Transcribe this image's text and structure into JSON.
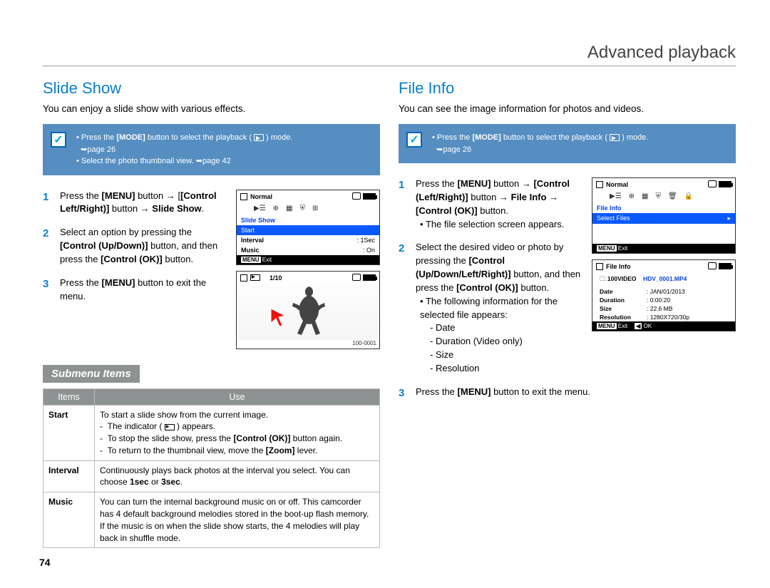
{
  "header": {
    "title": "Advanced playback"
  },
  "page_number": "74",
  "left": {
    "title": "Slide Show",
    "intro": "You can enjoy a slide show with various effects.",
    "callout": {
      "line1_pre": "Press the ",
      "line1_bold": "[MODE]",
      "line1_mid": " button to select the playback ( ",
      "line1_post": " ) mode. ",
      "line1_ref": "➥page 26",
      "line2": "Select the photo thumbnail view. ➥page 42"
    },
    "steps": {
      "s1": {
        "num": "1",
        "a": "Press the ",
        "b1": "[MENU]",
        "c": " button → ",
        "b2": "[Control Left/Right)]",
        "d": " button → ",
        "b3": "Slide Show",
        "e": "."
      },
      "s2": {
        "num": "2",
        "a": "Select an option by pressing the ",
        "b1": "[Control (Up/Down)]",
        "c": " button, and then press the ",
        "b2": "[Control (OK)]",
        "d": " button."
      },
      "s3": {
        "num": "3",
        "a": "Press the ",
        "b1": "[MENU]",
        "c": " button to exit the menu."
      }
    },
    "screen1": {
      "bar_label": "Normal",
      "menu_title": "Slide Show",
      "row1": "Start",
      "row2_label": "Interval",
      "row2_val": ": 1Sec",
      "row3_label": "Music",
      "row3_val": ": On",
      "footer_menu": "MENU",
      "footer_exit": "Exit"
    },
    "screen2": {
      "counter": "1/10",
      "footer_id": "100-0001"
    },
    "sub_heading": "Submenu Items",
    "table": {
      "h1": "Items",
      "h2": "Use",
      "r1_label": "Start",
      "r1_l1": "To start a slide show from the current image.",
      "r1_l2a": "The indicator ( ",
      "r1_l2b": " ) appears.",
      "r1_l3a": "To stop the slide show, press the ",
      "r1_l3b": "[Control (OK)]",
      "r1_l3c": " button again.",
      "r1_l4a": "To return to the thumbnail view, move the ",
      "r1_l4b": "[Zoom]",
      "r1_l4c": " lever.",
      "r2_label": "Interval",
      "r2_l1a": "Continuously plays back photos at the interval you select. You can choose ",
      "r2_l1b": "1sec",
      "r2_l1c": " or ",
      "r2_l1d": "3sec",
      "r2_l1e": ".",
      "r3_label": "Music",
      "r3_text": "You can turn the internal background music on or off. This camcorder has 4 default background melodies stored in the boot-up flash memory. If the music is on when the slide show starts, the 4 melodies will play back in shuffle mode."
    }
  },
  "right": {
    "title": "File Info",
    "intro": "You can see the image information for photos and videos.",
    "callout": {
      "line1_pre": "Press the ",
      "line1_bold": "[MODE]",
      "line1_mid": " button to select the playback ( ",
      "line1_post": " ) mode. ",
      "line1_ref": "➥page 26"
    },
    "steps": {
      "s1": {
        "num": "1",
        "a": "Press the ",
        "b1": "[MENU]",
        "c": " button → ",
        "b2": "[Control (Left/Right)]",
        "d": " button → ",
        "b3": "File Info",
        "e": " → ",
        "b4": "[Control (OK)]",
        "f": " button.",
        "sub": "The file selection screen appears."
      },
      "s2": {
        "num": "2",
        "a": "Select the desired video or photo by pressing the ",
        "b1": "[Control (Up/Down/Left/Right)]",
        "c": " button, and then press the ",
        "b2": "[Control (OK)]",
        "d": " button.",
        "sub_intro": "The following information for the selected file appears:",
        "i1": "Date",
        "i2": "Duration (Video only)",
        "i3": "Size",
        "i4": "Resolution"
      },
      "s3": {
        "num": "3",
        "a": "Press the ",
        "b1": "[MENU]",
        "c": " button to exit the menu."
      }
    },
    "screen1": {
      "bar_label": "Normal",
      "menu_title": "File Info",
      "row1": "Select Files",
      "footer_menu": "MENU",
      "footer_exit": "Exit"
    },
    "screen2": {
      "bar_label": "File Info",
      "folder": "100VIDEO",
      "file": "HDV_0001.MP4",
      "k1": "Date",
      "v1": ": JAN/01/2013",
      "k2": "Duration",
      "v2": ": 0:00:20",
      "k3": "Size",
      "v3": ": 22.6 MB",
      "k4": "Resolution",
      "v4": ": 1280X720/30p",
      "footer_menu": "MENU",
      "footer_exit": "Exit",
      "footer_ok_icon": "◀",
      "footer_ok": "OK"
    }
  }
}
